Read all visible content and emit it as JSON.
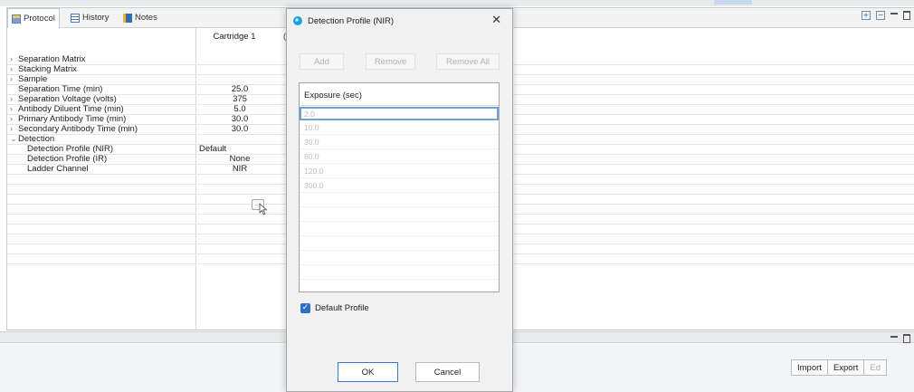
{
  "tabs": [
    {
      "label": "Protocol",
      "icon": "protocol-icon",
      "active": true
    },
    {
      "label": "History",
      "icon": "history-icon",
      "active": false
    },
    {
      "label": "Notes",
      "icon": "notes-icon",
      "active": false
    }
  ],
  "grid": {
    "column_header": "Cartridge 1",
    "rows": [
      {
        "label": "Separation Matrix",
        "chevron": ">",
        "value": ""
      },
      {
        "label": "Stacking Matrix",
        "chevron": ">",
        "value": ""
      },
      {
        "label": "Sample",
        "chevron": ">",
        "value": ""
      },
      {
        "label": "Separation Time (min)",
        "chevron": "",
        "value": "25.0"
      },
      {
        "label": "Separation Voltage (volts)",
        "chevron": ">",
        "value": "375"
      },
      {
        "label": "Antibody Diluent Time (min)",
        "chevron": ">",
        "value": "5.0"
      },
      {
        "label": "Primary Antibody Time (min)",
        "chevron": ">",
        "value": "30.0"
      },
      {
        "label": "Secondary Antibody Time (min)",
        "chevron": ">",
        "value": "30.0"
      },
      {
        "label": "Detection",
        "chevron": "v",
        "value": ""
      },
      {
        "label": "Detection Profile (NIR)",
        "chevron": "",
        "value": "Default",
        "indent": true
      },
      {
        "label": "Detection Profile (IR)",
        "chevron": "",
        "value": "None",
        "indent": true
      },
      {
        "label": "Ladder Channel",
        "chevron": "",
        "value": "NIR",
        "indent": true
      }
    ]
  },
  "bottom_buttons": {
    "import": "Import",
    "export": "Export",
    "edit": "Ed"
  },
  "dialog": {
    "title": "Detection Profile (NIR)",
    "add": "Add",
    "remove": "Remove",
    "remove_all": "Remove All",
    "column_header": "Exposure (sec)",
    "exposures": [
      "2.0",
      "10.0",
      "30.0",
      "60.0",
      "120.0",
      "300.0"
    ],
    "default_profile_label": "Default Profile",
    "default_profile_checked": true,
    "ok": "OK",
    "cancel": "Cancel"
  },
  "colors": {
    "accent": "#2c6fc4",
    "selection_border": "#6ea3d8"
  }
}
